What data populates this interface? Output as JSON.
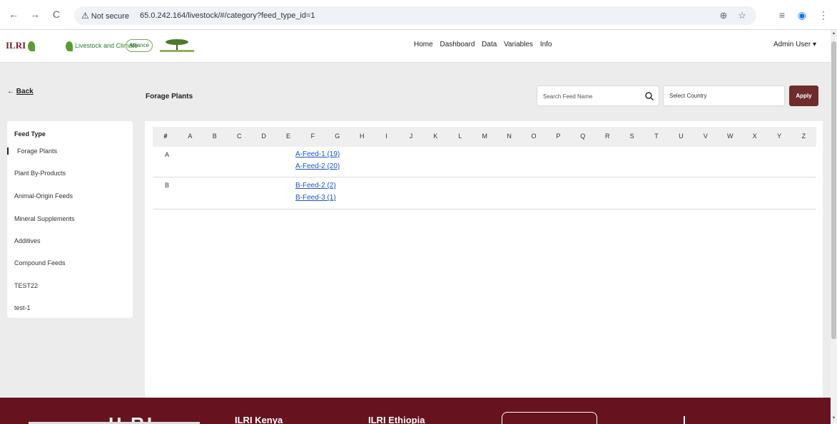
{
  "browser": {
    "back_icon": "←",
    "forward_icon": "→",
    "reload_icon": "C",
    "security_label": "Not secure",
    "url": "65.0.242.164/livestock/#/category?feed_type_id=1",
    "zoom_icon": "⊕",
    "star_icon": "☆",
    "media_icon": "≡",
    "profile_icon": "◉",
    "menu_icon": "⋮"
  },
  "header": {
    "logos": {
      "ilri": "ILRI",
      "cgiar_1": "CGIAR",
      "livestock_climate": "Livestock and Climate",
      "alliance": "Alliance"
    },
    "nav": [
      "Home",
      "Dashboard",
      "Data",
      "Variables",
      "Info"
    ],
    "user": "Admin User ▾"
  },
  "toolbar": {
    "back_arrow": "←",
    "back_label": "Back",
    "title": "Forage Plants",
    "search_placeholder": "Search Feed Name",
    "country_placeholder": "Select Country",
    "apply_label": "Apply"
  },
  "sidebar": {
    "heading": "Feed Type",
    "items": [
      {
        "label": "Forage Plants",
        "active": true
      },
      {
        "label": "Plant By-Products",
        "active": false
      },
      {
        "label": "Animal-Origin Feeds",
        "active": false
      },
      {
        "label": "Mineral Supplements",
        "active": false
      },
      {
        "label": "Additives",
        "active": false
      },
      {
        "label": "Compound Feeds",
        "active": false
      },
      {
        "label": "TEST22",
        "active": false
      },
      {
        "label": "test-1",
        "active": false
      }
    ]
  },
  "alphabet": {
    "letters": [
      "#",
      "A",
      "B",
      "C",
      "D",
      "E",
      "F",
      "G",
      "H",
      "I",
      "J",
      "K",
      "L",
      "M",
      "N",
      "O",
      "P",
      "Q",
      "R",
      "S",
      "T",
      "U",
      "V",
      "W",
      "X",
      "Y",
      "Z"
    ],
    "active": "#"
  },
  "groups": [
    {
      "letter": "A",
      "feeds": [
        "A-Feed-1 (19)",
        "A-Feed-2 (20)"
      ]
    },
    {
      "letter": "B",
      "feeds": [
        "B-Feed-2 (2)",
        "B-Feed-3 (1)"
      ]
    }
  ],
  "footer": {
    "logo": "ILRI",
    "col1": "ILRI Kenya",
    "col2": "ILRI Ethiopia"
  },
  "colors": {
    "accent": "#6e2c2c",
    "footer": "#66121f",
    "link": "#1a56c9"
  }
}
